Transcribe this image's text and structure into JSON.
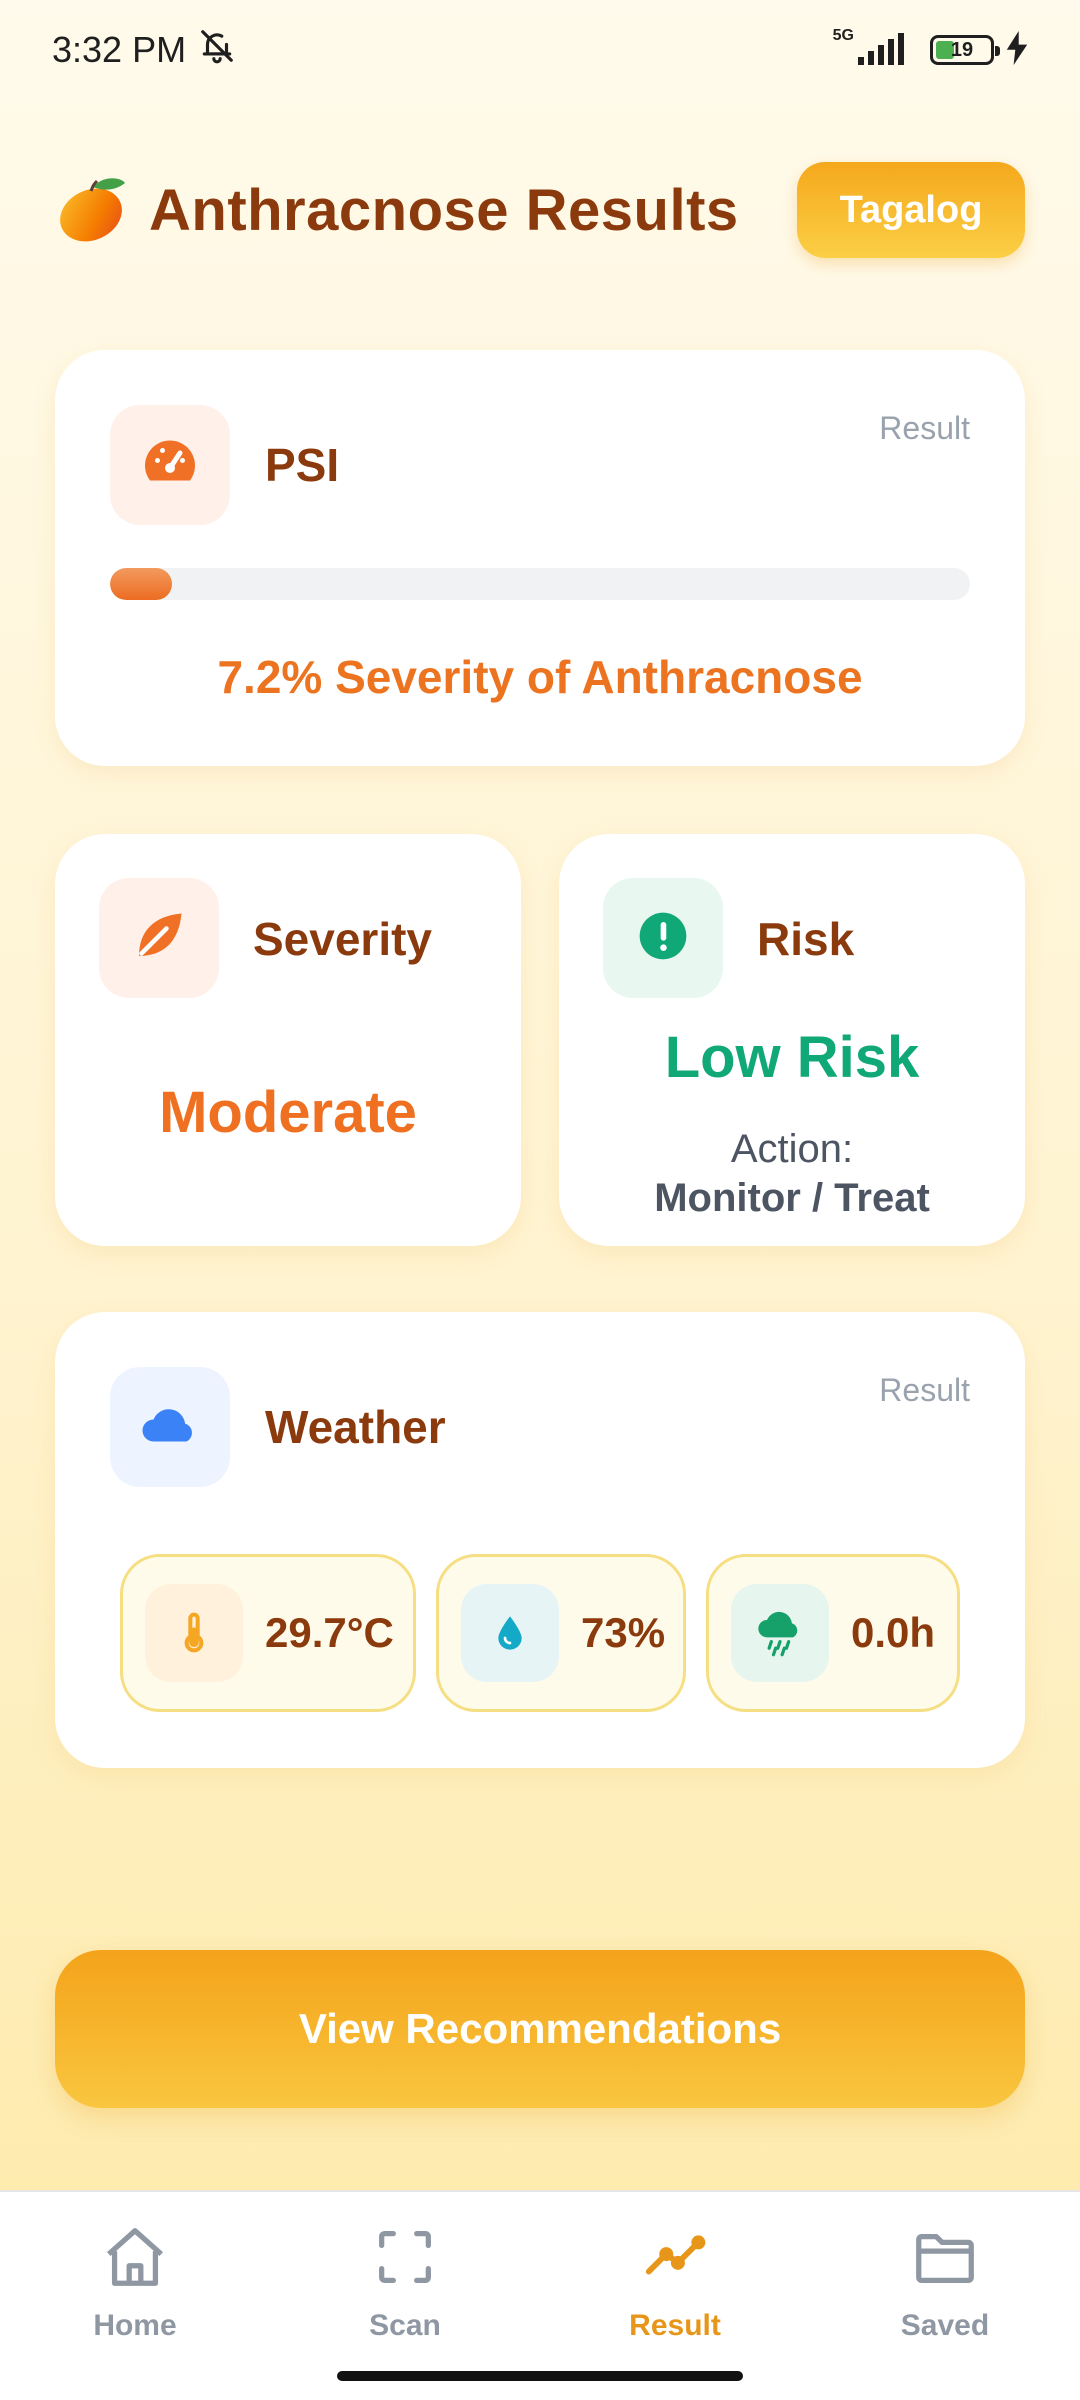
{
  "status_bar": {
    "time": "3:32 PM",
    "network": "5G",
    "battery": "19"
  },
  "header": {
    "title": "Anthracnose Results",
    "language_button": "Tagalog"
  },
  "psi_card": {
    "title": "PSI",
    "tag": "Result",
    "progress_percent": 7.2,
    "summary": "7.2% Severity of Anthracnose"
  },
  "severity_card": {
    "title": "Severity",
    "value": "Moderate"
  },
  "risk_card": {
    "title": "Risk",
    "value": "Low Risk",
    "action_label": "Action:",
    "action_value": "Monitor / Treat"
  },
  "weather_card": {
    "title": "Weather",
    "tag": "Result",
    "temperature": "29.7°C",
    "humidity": "73%",
    "rain": "0.0h"
  },
  "recommend_button": "View Recommendations",
  "nav": {
    "items": [
      {
        "label": "Home",
        "icon": "home-icon"
      },
      {
        "label": "Scan",
        "icon": "scan-icon"
      },
      {
        "label": "Result",
        "icon": "trend-icon",
        "active": true
      },
      {
        "label": "Saved",
        "icon": "folder-icon"
      }
    ]
  },
  "colors": {
    "accent": "#f5a81c",
    "title": "#8a3a0c",
    "severity": "#ef7020",
    "low_risk": "#11a877"
  }
}
